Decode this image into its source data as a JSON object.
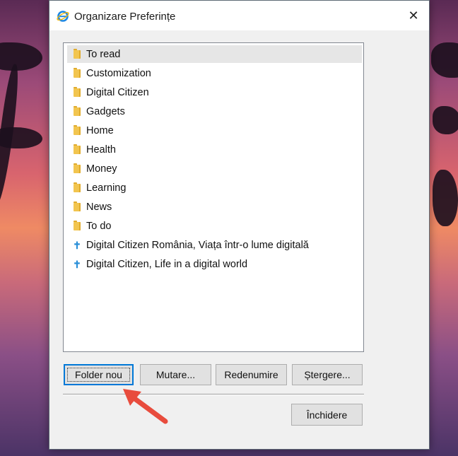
{
  "window": {
    "title": "Organizare Preferințe",
    "close_glyph": "✕"
  },
  "favorites": [
    {
      "type": "folder",
      "label": "To read",
      "selected": true
    },
    {
      "type": "folder",
      "label": "Customization"
    },
    {
      "type": "folder",
      "label": "Digital Citizen"
    },
    {
      "type": "folder",
      "label": "Gadgets"
    },
    {
      "type": "folder",
      "label": "Home"
    },
    {
      "type": "folder",
      "label": "Health"
    },
    {
      "type": "folder",
      "label": "Money"
    },
    {
      "type": "folder",
      "label": "Learning"
    },
    {
      "type": "folder",
      "label": "News"
    },
    {
      "type": "folder",
      "label": "To do"
    },
    {
      "type": "link",
      "label": "Digital Citizen România, Viața într-o lume digitală",
      "icon": "✝"
    },
    {
      "type": "link",
      "label": "Digital Citizen, Life in a digital world",
      "icon": "✝"
    }
  ],
  "buttons": {
    "new_folder": "Folder nou",
    "move": "Mutare...",
    "rename": "Redenumire",
    "delete": "Ștergere...",
    "close": "Închidere"
  },
  "colors": {
    "accent": "#0078d7",
    "arrow": "#e84c3d",
    "folder": "#f2c54f",
    "link_icon": "#2a8fd8"
  }
}
